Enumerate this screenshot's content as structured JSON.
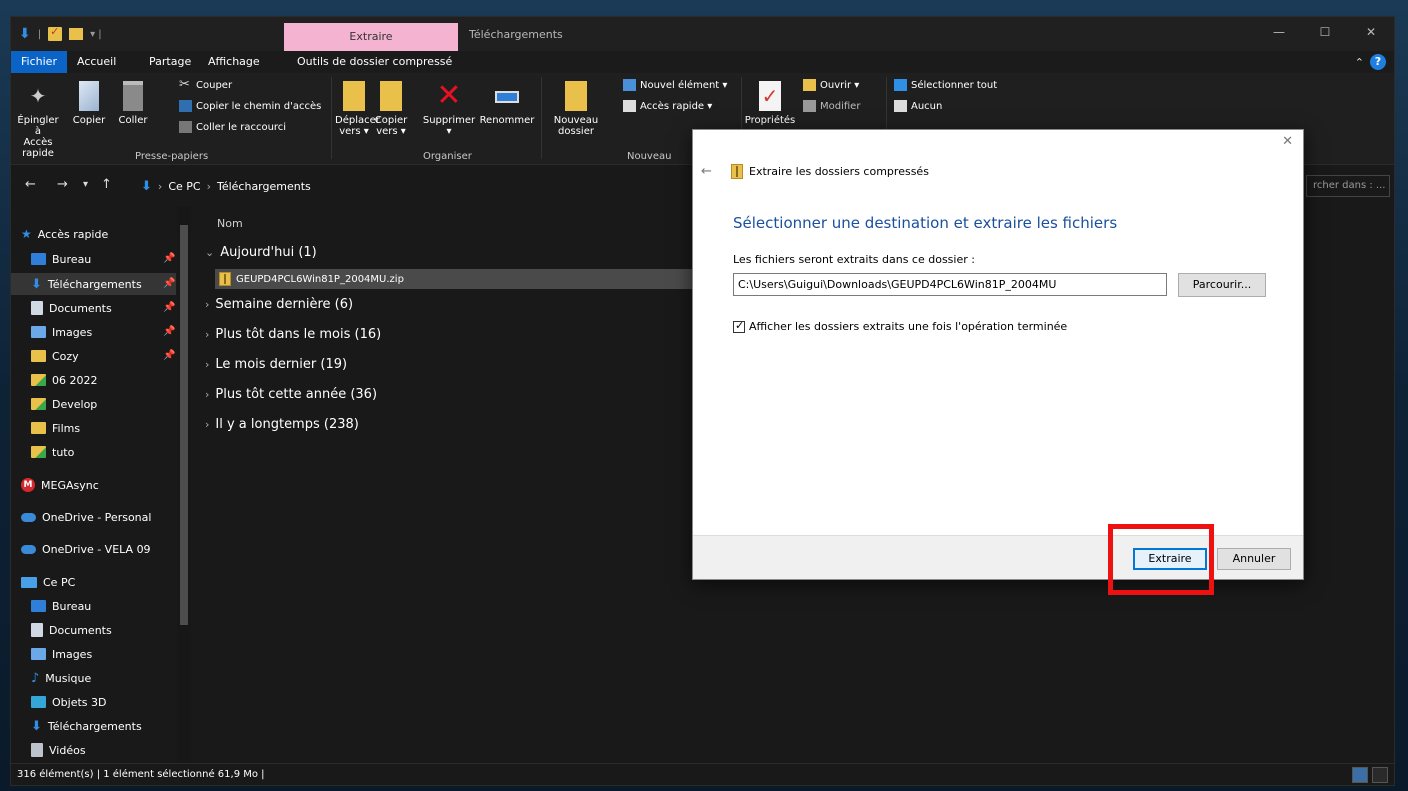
{
  "titlebar": {
    "context_tab": "Extraire",
    "title": "Téléchargements",
    "minimize": "—",
    "maximize": "☐",
    "close": "✕"
  },
  "tabs": {
    "file": "Fichier",
    "home": "Accueil",
    "share": "Partage",
    "view": "Affichage",
    "compressed_tools": "Outils de dossier compressé",
    "collapse": "⌃",
    "help": "?"
  },
  "ribbon": {
    "pin_label_1": "Épingler à",
    "pin_label_2": "Accès rapide",
    "copy": "Copier",
    "paste": "Coller",
    "cut": "Couper",
    "copy_path": "Copier le chemin d'accès",
    "paste_shortcut": "Coller le raccourci",
    "group_clipboard": "Presse-papiers",
    "move_to_1": "Déplacer",
    "move_to_2": "vers ▾",
    "copy_to_1": "Copier",
    "copy_to_2": "vers ▾",
    "delete": "Supprimer",
    "delete_arrow": "▾",
    "rename": "Renommer",
    "group_organize": "Organiser",
    "new_folder_1": "Nouveau",
    "new_folder_2": "dossier",
    "new_item": "Nouvel élément ▾",
    "quick_access": "Accès rapide ▾",
    "group_new": "Nouveau",
    "properties": "Propriétés",
    "open": "Ouvrir ▾",
    "edit": "Modifier",
    "select_all": "Sélectionner tout",
    "select_none": "Aucun"
  },
  "address": {
    "back": "←",
    "forward": "→",
    "recent": "▾",
    "up": "↑",
    "crumb_sep": "›",
    "crumb_pc": "Ce PC",
    "crumb_downloads": "Téléchargements",
    "search_placeholder": "rcher dans : ..."
  },
  "sidebar": {
    "quick_access": "Accès rapide",
    "items": [
      {
        "label": "Bureau",
        "pinned": "📌"
      },
      {
        "label": "Téléchargements",
        "pinned": "📌"
      },
      {
        "label": "Documents",
        "pinned": "📌"
      },
      {
        "label": "Images",
        "pinned": "📌"
      },
      {
        "label": "Cozy",
        "pinned": "📌"
      },
      {
        "label": "06 2022"
      },
      {
        "label": "Develop"
      },
      {
        "label": "Films"
      },
      {
        "label": "tuto"
      }
    ],
    "mega": "MEGAsync",
    "onedrive_personal": "OneDrive - Personal",
    "onedrive_vela": "OneDrive - VELA 09",
    "this_pc": "Ce PC",
    "pc_items": [
      "Bureau",
      "Documents",
      "Images",
      "Musique",
      "Objets 3D",
      "Téléchargements",
      "Vidéos"
    ]
  },
  "filelist": {
    "col_name": "Nom",
    "groups": [
      {
        "label": "Aujourd'hui (1)",
        "expanded": true
      },
      {
        "label": "Semaine dernière (6)",
        "expanded": false
      },
      {
        "label": "Plus tôt dans le mois (16)",
        "expanded": false
      },
      {
        "label": "Le mois dernier (19)",
        "expanded": false
      },
      {
        "label": "Plus tôt cette année (36)",
        "expanded": false
      },
      {
        "label": "Il y a longtemps (238)",
        "expanded": false
      }
    ],
    "selected_file": "GEUPD4PCL6Win81P_2004MU.zip"
  },
  "statusbar": {
    "text": "316 élément(s)  |  1 élément sélectionné  61,9 Mo  |"
  },
  "dialog": {
    "close": "✕",
    "back": "←",
    "header": "Extraire les dossiers compressés",
    "title": "Sélectionner une destination et extraire les fichiers",
    "path_label": "Les fichiers seront extraits dans ce dossier :",
    "path_value": "C:\\Users\\Guigui\\Downloads\\GEUPD4PCL6Win81P_2004MU",
    "browse": "Parcourir...",
    "checkbox_label": "Afficher les dossiers extraits une fois l'opération terminée",
    "checkbox_checked": true,
    "extract": "Extraire",
    "cancel": "Annuler"
  },
  "colors": {
    "accent": "#0078d7",
    "context_tab": "#f3b3d1",
    "highlight": "#ee1111",
    "folder": "#e9c14a"
  }
}
